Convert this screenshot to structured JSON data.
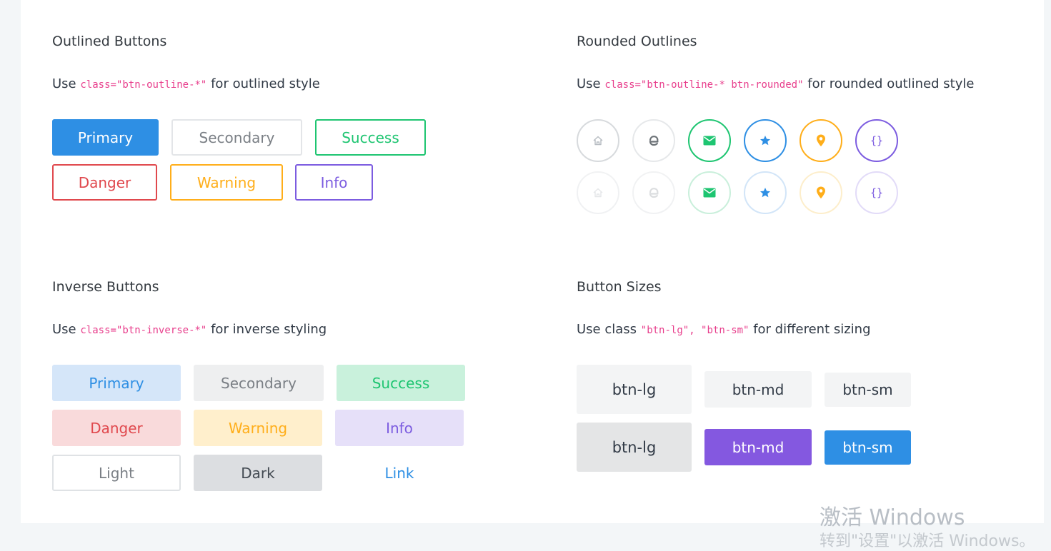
{
  "outlined": {
    "title": "Outlined Buttons",
    "desc_pre": "Use ",
    "desc_code": "class=\"btn-outline-*\"",
    "desc_post": " for outlined style",
    "buttons": [
      "Primary",
      "Secondary",
      "Success",
      "Danger",
      "Warning",
      "Info"
    ]
  },
  "rounded": {
    "title": "Rounded Outlines",
    "desc_pre": "Use ",
    "desc_code": "class=\"btn-outline-* btn-rounded\"",
    "desc_post": " for rounded outlined style",
    "icons": [
      "home-icon",
      "edge-icon",
      "mail-icon",
      "star-icon",
      "map-pin-icon",
      "code-braces-icon"
    ]
  },
  "inverse": {
    "title": "Inverse Buttons",
    "desc_pre": "Use ",
    "desc_code": "class=\"btn-inverse-*\"",
    "desc_post": " for inverse styling",
    "buttons": [
      "Primary",
      "Secondary",
      "Success",
      "Danger",
      "Warning",
      "Info",
      "Light",
      "Dark",
      "Link"
    ]
  },
  "sizes": {
    "title": "Button Sizes",
    "desc_pre": "Use class ",
    "desc_code": "\"btn-lg\", \"btn-sm\"",
    "desc_post": " for different sizing",
    "row1": [
      "btn-lg",
      "btn-md",
      "btn-sm"
    ],
    "row2": [
      "btn-lg",
      "btn-md",
      "btn-sm"
    ]
  },
  "watermark": {
    "line1": "激活 Windows",
    "line2": "转到\"设置\"以激活 Windows。"
  },
  "colors": {
    "primary": "#2e8fe4",
    "secondary": "#7a7f85",
    "success": "#1ec571",
    "danger": "#e0484d",
    "warning": "#ffae1a",
    "info": "#7c5ce0",
    "purple_btn": "#8458e0",
    "code": "#e83e8c"
  }
}
